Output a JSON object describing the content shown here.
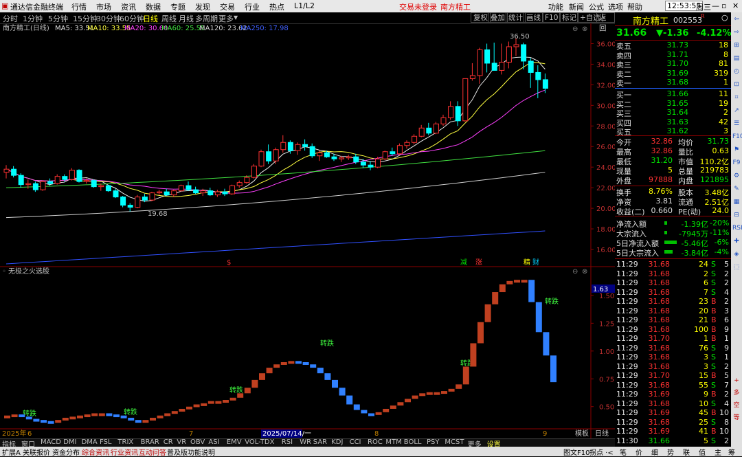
{
  "app": {
    "title": "通达信金融终端",
    "time": "12:53:55",
    "weekday": "周三",
    "trade_status": "交易未登录",
    "stock_tag": "南方精工"
  },
  "menu": [
    "行情",
    "市场",
    "资讯",
    "数据",
    "专题",
    "发现",
    "交易",
    "行业",
    "热点",
    "L1/L2"
  ],
  "menu_right": [
    "功能",
    "新闻",
    "公式",
    "选项",
    "帮助"
  ],
  "periods": [
    "分时",
    "1分钟",
    "5分钟",
    "15分钟",
    "30分钟",
    "60分钟",
    "日线",
    "周线",
    "月线",
    "多周期",
    "更多"
  ],
  "toolbar_right": [
    "复权",
    "叠加",
    "统计",
    "画线",
    "F10",
    "标记",
    "+自选",
    "返回"
  ],
  "chart_header": {
    "title": "南方精工(日线)",
    "ma5": "MA5: 33.51",
    "ma10": "MA10: 33.55",
    "ma20": "MA20: 30.60",
    "ma60": "MA60: 25.55",
    "ma120": "MA120: 23.62",
    "ma250": "MA250: 17.98"
  },
  "indicator": {
    "title": "无极之火选股",
    "current": "1.63"
  },
  "chart_labels": {
    "high": "36.50",
    "low": "19.68",
    "date": "2025/07/14/一",
    "year": "2025年",
    "m6": "6",
    "m7": "7",
    "m8": "8",
    "m9": "9",
    "period": "日线",
    "board": "模板",
    "mark_s": "$",
    "mark_jian": "减",
    "mark_zhang": "涨",
    "mark_jing": "精",
    "mark_cai": "财",
    "sig": "转跌"
  },
  "chart_data": {
    "type": "candlestick",
    "title": "南方精工(日线)",
    "y_ticks": [
      16,
      18,
      20,
      22,
      24,
      26,
      28,
      30,
      32,
      34,
      36
    ],
    "ind_ticks": [
      0.5,
      0.75,
      1.0,
      1.25,
      1.5
    ],
    "candles": [
      [
        23.5,
        24.2,
        22.9,
        23.8
      ],
      [
        23.8,
        24.1,
        23.0,
        23.2
      ],
      [
        23.2,
        23.4,
        22.0,
        22.3
      ],
      [
        22.3,
        22.8,
        21.9,
        22.4
      ],
      [
        22.4,
        22.6,
        21.6,
        21.8
      ],
      [
        21.8,
        22.7,
        21.7,
        22.6
      ],
      [
        22.6,
        22.9,
        22.2,
        22.4
      ],
      [
        22.4,
        23.3,
        22.3,
        23.1
      ],
      [
        23.1,
        23.3,
        22.6,
        22.8
      ],
      [
        22.8,
        23.9,
        22.7,
        23.7
      ],
      [
        23.7,
        23.8,
        22.5,
        22.6
      ],
      [
        22.6,
        22.9,
        22.4,
        22.7
      ],
      [
        22.7,
        22.8,
        22.0,
        22.1
      ],
      [
        22.1,
        22.4,
        21.7,
        22.2
      ],
      [
        22.2,
        22.3,
        21.6,
        21.7
      ],
      [
        21.7,
        21.9,
        21.0,
        21.1
      ],
      [
        21.1,
        21.2,
        20.1,
        20.3
      ],
      [
        20.3,
        20.5,
        19.68,
        20.1
      ],
      [
        20.1,
        21.3,
        20.0,
        21.1
      ],
      [
        21.1,
        21.4,
        20.6,
        20.8
      ],
      [
        20.8,
        21.6,
        20.7,
        21.5
      ],
      [
        21.5,
        21.8,
        21.3,
        21.6
      ],
      [
        21.6,
        21.9,
        21.2,
        21.3
      ],
      [
        21.3,
        21.8,
        21.1,
        21.7
      ],
      [
        21.7,
        22.3,
        21.6,
        22.2
      ],
      [
        22.2,
        22.6,
        21.7,
        21.8
      ],
      [
        21.8,
        22.1,
        21.4,
        21.5
      ],
      [
        21.5,
        21.9,
        21.2,
        21.7
      ],
      [
        21.7,
        22.0,
        21.2,
        21.3
      ],
      [
        21.3,
        21.8,
        21.1,
        21.6
      ],
      [
        21.6,
        21.9,
        21.2,
        21.4
      ],
      [
        21.4,
        22.3,
        21.3,
        22.2
      ],
      [
        22.2,
        22.7,
        22.0,
        22.5
      ],
      [
        22.5,
        23.2,
        22.4,
        23.0
      ],
      [
        23.0,
        24.3,
        22.9,
        24.1
      ],
      [
        24.1,
        25.7,
        24.0,
        25.5
      ],
      [
        25.5,
        26.2,
        24.3,
        24.6
      ],
      [
        24.6,
        25.9,
        24.3,
        25.7
      ],
      [
        25.7,
        27.1,
        25.4,
        26.4
      ],
      [
        26.4,
        26.6,
        25.3,
        25.6
      ],
      [
        25.6,
        26.4,
        25.2,
        26.2
      ],
      [
        26.2,
        26.7,
        25.6,
        26.0
      ],
      [
        26.0,
        26.3,
        24.9,
        25.1
      ],
      [
        25.1,
        25.6,
        24.6,
        25.4
      ],
      [
        25.4,
        25.6,
        24.9,
        25.0
      ],
      [
        25.0,
        25.3,
        24.6,
        24.8
      ],
      [
        24.8,
        25.1,
        24.5,
        24.9
      ],
      [
        24.9,
        25.2,
        24.7,
        25.0
      ],
      [
        25.0,
        25.3,
        24.3,
        24.5
      ],
      [
        24.5,
        24.8,
        23.9,
        24.2
      ],
      [
        24.2,
        24.6,
        23.7,
        24.0
      ],
      [
        24.0,
        25.0,
        23.9,
        24.8
      ],
      [
        24.8,
        25.6,
        24.7,
        25.5
      ],
      [
        25.5,
        25.9,
        25.1,
        25.3
      ],
      [
        25.3,
        26.3,
        25.2,
        26.1
      ],
      [
        26.1,
        26.6,
        25.8,
        26.4
      ],
      [
        26.4,
        27.2,
        26.2,
        27.0
      ],
      [
        27.0,
        28.1,
        26.9,
        27.8
      ],
      [
        27.8,
        28.3,
        27.1,
        27.3
      ],
      [
        27.3,
        28.4,
        27.2,
        28.2
      ],
      [
        28.2,
        29.1,
        28.0,
        28.8
      ],
      [
        28.8,
        30.4,
        28.6,
        29.9
      ],
      [
        29.9,
        30.4,
        28.0,
        28.5
      ],
      [
        28.5,
        31.1,
        28.4,
        32.6
      ],
      [
        32.6,
        34.1,
        32.4,
        32.9
      ],
      [
        32.9,
        35.6,
        32.1,
        35.4
      ],
      [
        35.4,
        36.0,
        33.2,
        34.1
      ],
      [
        34.1,
        36.1,
        33.6,
        33.4
      ],
      [
        33.4,
        36.0,
        33.0,
        34.2
      ],
      [
        34.2,
        36.2,
        33.6,
        35.7
      ],
      [
        35.7,
        36.5,
        34.8,
        35.9
      ],
      [
        35.9,
        36.1,
        33.5,
        34.3
      ],
      [
        34.3,
        34.6,
        31.7,
        33.2
      ],
      [
        33.2,
        33.9,
        30.7,
        32.5
      ],
      [
        32.5,
        33.1,
        31.2,
        31.66
      ]
    ],
    "indicator_values": [
      0.42,
      0.43,
      0.41,
      0.39,
      0.38,
      0.37,
      0.36,
      0.38,
      0.4,
      0.41,
      0.42,
      0.43,
      0.44,
      0.44,
      0.43,
      0.42,
      0.4,
      0.38,
      0.37,
      0.38,
      0.4,
      0.42,
      0.44,
      0.46,
      0.48,
      0.5,
      0.52,
      0.53,
      0.55,
      0.55,
      0.56,
      0.58,
      0.62,
      0.67,
      0.74,
      0.8,
      0.85,
      0.88,
      0.9,
      0.91,
      0.9,
      0.88,
      0.85,
      0.8,
      0.74,
      0.67,
      0.6,
      0.52,
      0.47,
      0.44,
      0.43,
      0.45,
      0.48,
      0.51,
      0.54,
      0.57,
      0.6,
      0.62,
      0.63,
      0.63,
      0.64,
      0.66,
      0.7,
      0.86,
      1.07,
      1.26,
      1.42,
      1.53,
      1.6,
      1.63,
      1.64,
      1.64,
      1.44,
      1.17,
      0.96,
      0.72
    ]
  },
  "quote": {
    "name": "南方精工",
    "code": "002553",
    "r": "R",
    "price": "31.66",
    "change": "▼-1.36",
    "pct": "-4.12%",
    "asks": [
      [
        "卖五",
        "31.73",
        "18"
      ],
      [
        "卖四",
        "31.71",
        "8"
      ],
      [
        "卖三",
        "31.70",
        "81"
      ],
      [
        "卖二",
        "31.69",
        "319"
      ],
      [
        "卖一",
        "31.68",
        "1"
      ]
    ],
    "bids": [
      [
        "买一",
        "31.66",
        "11"
      ],
      [
        "买二",
        "31.65",
        "19"
      ],
      [
        "买三",
        "31.64",
        "2"
      ],
      [
        "买四",
        "31.63",
        "42"
      ],
      [
        "买五",
        "31.62",
        "3"
      ]
    ],
    "stats": [
      [
        "今开",
        "32.86",
        "均价",
        "31.73"
      ],
      [
        "最高",
        "32.86",
        "量比",
        "0.63"
      ],
      [
        "最低",
        "31.20",
        "市值",
        "110.2亿"
      ],
      [
        "现量",
        "5",
        "总量",
        "219783"
      ],
      [
        "外盘",
        "97888",
        "内盘",
        "121895"
      ]
    ],
    "stats2": [
      [
        "换手",
        "8.76%",
        "股本",
        "3.48亿"
      ],
      [
        "净资",
        "3.81",
        "流通",
        "2.51亿"
      ],
      [
        "收益(二)",
        "0.660",
        "PE(动)",
        "24.0"
      ]
    ],
    "flows": [
      [
        "净流入额",
        "-1.39亿",
        "-20%"
      ],
      [
        "大宗流入",
        "-7945万",
        "-11%"
      ],
      [
        "5日净流入额",
        "-5.46亿",
        "-6%"
      ],
      [
        "5日大宗流入",
        "-3.84亿",
        "-4%"
      ]
    ],
    "ticks": [
      [
        "11:29",
        "31.68",
        "24",
        "S",
        "5"
      ],
      [
        "11:29",
        "31.68",
        "2",
        "S",
        "2"
      ],
      [
        "11:29",
        "31.68",
        "6",
        "S",
        "2"
      ],
      [
        "11:29",
        "31.68",
        "7",
        "S",
        "4"
      ],
      [
        "11:29",
        "31.68",
        "23",
        "B",
        "2"
      ],
      [
        "11:29",
        "31.68",
        "20",
        "B",
        "3"
      ],
      [
        "11:29",
        "31.68",
        "21",
        "B",
        "6"
      ],
      [
        "11:29",
        "31.68",
        "100",
        "B",
        "9"
      ],
      [
        "11:29",
        "31.70",
        "1",
        "B",
        "1"
      ],
      [
        "11:29",
        "31.68",
        "76",
        "S",
        "9"
      ],
      [
        "11:29",
        "31.68",
        "3",
        "S",
        "1"
      ],
      [
        "11:29",
        "31.68",
        "3",
        "S",
        "2"
      ],
      [
        "11:29",
        "31.70",
        "15",
        "B",
        "5"
      ],
      [
        "11:29",
        "31.68",
        "55",
        "S",
        "7"
      ],
      [
        "11:29",
        "31.69",
        "9",
        "B",
        "2"
      ],
      [
        "11:29",
        "31.68",
        "10",
        "S",
        "4"
      ],
      [
        "11:29",
        "31.69",
        "45",
        "B",
        "10"
      ],
      [
        "11:29",
        "31.68",
        "25",
        "S",
        "8"
      ],
      [
        "11:29",
        "31.69",
        "41",
        "B",
        "10"
      ],
      [
        "11:30",
        "31.66",
        "5",
        "S",
        "2"
      ]
    ]
  },
  "bottom_tabs": [
    "指标",
    "窗口",
    "MACD",
    "DMI",
    "DMA",
    "FSL",
    "TRIX",
    "BRAR",
    "CR",
    "VR",
    "OBV",
    "ASI",
    "EMV",
    "VOL-TDX",
    "RSI",
    "WR",
    "SAR",
    "KDJ",
    "CCI",
    "ROC",
    "MTM",
    "BOLL",
    "PSY",
    "MCST",
    "更多",
    "设置"
  ],
  "status_left": [
    "扩展A",
    "关联报价",
    "资金分布",
    "综合资讯",
    "行业资讯",
    "互动问答",
    "普及版功能说明"
  ],
  "status_right": [
    "图文F10",
    "拐点 ·<",
    "笔",
    "价",
    "细",
    "势",
    "联",
    "值",
    "主",
    "筹"
  ],
  "right_icons": [
    "⇦",
    "⇨",
    "⊞",
    "▤",
    "◴",
    "⊡",
    "⌗",
    "↗",
    "☰",
    "F10",
    "⚑",
    "F9",
    "⚙",
    "✎",
    "▦",
    "⊟",
    "RSI",
    "✚",
    "◈",
    "⬚"
  ]
}
